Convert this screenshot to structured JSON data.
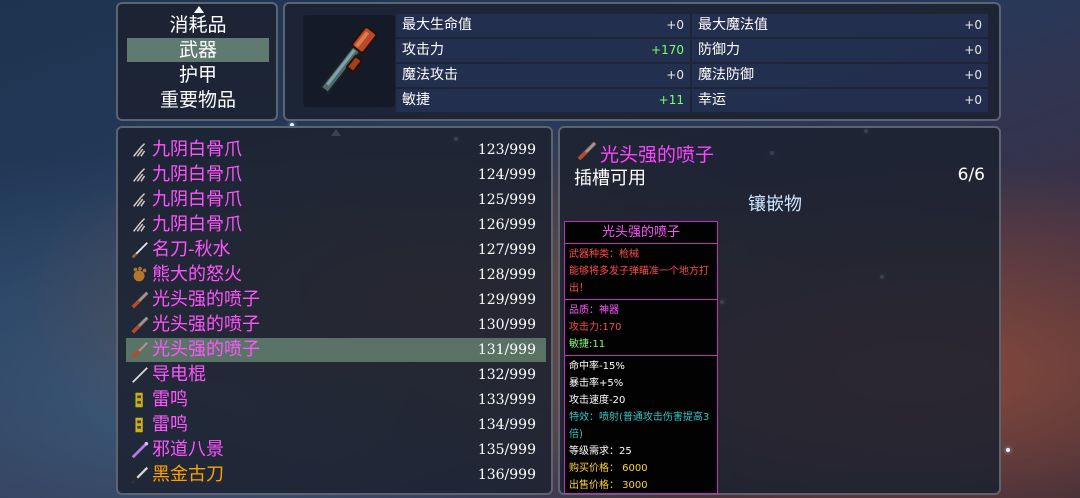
{
  "categories": {
    "items": [
      {
        "label": "消耗品"
      },
      {
        "label": "武器"
      },
      {
        "label": "护甲"
      },
      {
        "label": "重要物品"
      }
    ],
    "selected_index": 1
  },
  "stats": {
    "max_hp": {
      "label": "最大生命值",
      "value": "+0"
    },
    "max_mp": {
      "label": "最大魔法值",
      "value": "+0"
    },
    "attack": {
      "label": "攻击力",
      "value": "+170"
    },
    "defense": {
      "label": "防御力",
      "value": "+0"
    },
    "magic_attack": {
      "label": "魔法攻击",
      "value": "+0"
    },
    "magic_defense": {
      "label": "魔法防御",
      "value": "+0"
    },
    "agility": {
      "label": "敏捷",
      "value": "+11"
    },
    "luck": {
      "label": "幸运",
      "value": "+0"
    }
  },
  "item_list": [
    {
      "name": "九阴白骨爪",
      "count": "123/999",
      "color": "#ff55ff",
      "icon": "claw-icon"
    },
    {
      "name": "九阴白骨爪",
      "count": "124/999",
      "color": "#ff55ff",
      "icon": "claw-icon"
    },
    {
      "name": "九阴白骨爪",
      "count": "125/999",
      "color": "#ff55ff",
      "icon": "claw-icon"
    },
    {
      "name": "九阴白骨爪",
      "count": "126/999",
      "color": "#ff55ff",
      "icon": "claw-icon"
    },
    {
      "name": "名刀-秋水",
      "count": "127/999",
      "color": "#ff55ff",
      "icon": "sword-icon"
    },
    {
      "name": "熊大的怒火",
      "count": "128/999",
      "color": "#ff55ff",
      "icon": "bear-claw-icon"
    },
    {
      "name": "光头强的喷子",
      "count": "129/999",
      "color": "#ff55ff",
      "icon": "shotgun-icon"
    },
    {
      "name": "光头强的喷子",
      "count": "130/999",
      "color": "#ff55ff",
      "icon": "shotgun-icon"
    },
    {
      "name": "光头强的喷子",
      "count": "131/999",
      "color": "#ff55ff",
      "icon": "shotgun-icon"
    },
    {
      "name": "导电棍",
      "count": "132/999",
      "color": "#ff55ff",
      "icon": "baton-icon"
    },
    {
      "name": "雷鸣",
      "count": "133/999",
      "color": "#ff55ff",
      "icon": "thunder-icon"
    },
    {
      "name": "雷鸣",
      "count": "134/999",
      "color": "#ff55ff",
      "icon": "thunder-icon"
    },
    {
      "name": "邪道八景",
      "count": "135/999",
      "color": "#ff55ff",
      "icon": "wand-icon"
    },
    {
      "name": "黑金古刀",
      "count": "136/999",
      "color": "#ffa000",
      "icon": "blade-icon"
    }
  ],
  "selected_item_index": 8,
  "detail": {
    "name": "光头强的喷子",
    "socket_label": "插槽可用",
    "slots": "6/6",
    "inlay_label": "镶嵌物"
  },
  "tooltip": {
    "title": "光头强的喷子",
    "desc": [
      "武器种类：枪械",
      "能够将多发子弹瞄准一个地方打出！"
    ],
    "quality": "品质：神器",
    "attack": "攻击力:170",
    "agility": "敏捷:11",
    "hit_rate": "命中率-15%",
    "crit_rate": "暴击率+5%",
    "attack_speed": "攻击速度-20",
    "special": "特效：喷射(普通攻击伤害提高3倍)",
    "level_req": "等级需求：25",
    "buy_price": "购买价格： 6000",
    "sell_price": "出售价格： 3000"
  }
}
